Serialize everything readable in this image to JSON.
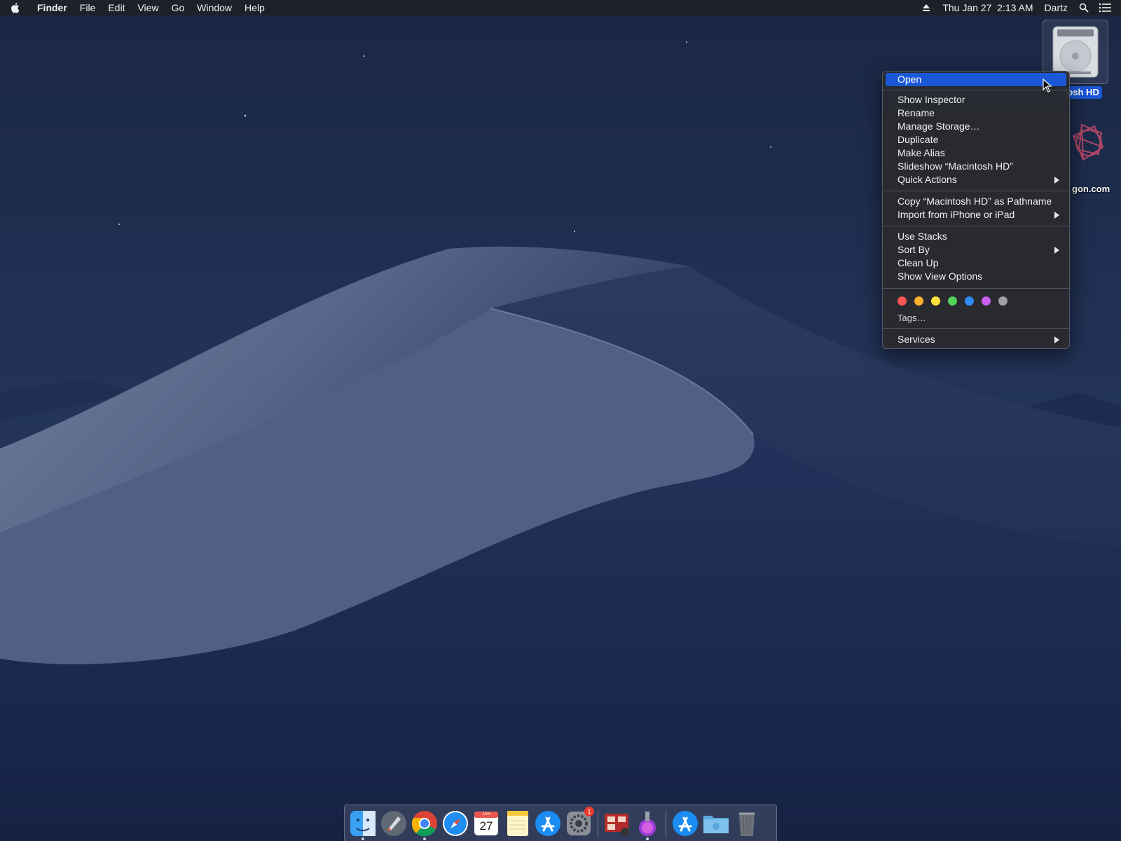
{
  "menubar": {
    "app_name": "Finder",
    "menus": [
      "File",
      "Edit",
      "View",
      "Go",
      "Window",
      "Help"
    ],
    "datetime": "Thu Jan 27  2:13 AM",
    "user": "Dartz",
    "icons": [
      "apple-icon",
      "eject-icon",
      "spotlight-search-icon",
      "notification-center-icon"
    ]
  },
  "desktop": {
    "selected_item_label": "tosh HD",
    "second_item_label": "gon.com"
  },
  "context_menu": {
    "open": "Open",
    "group2": [
      "Show Inspector",
      "Rename",
      "Manage Storage…",
      "Duplicate",
      "Make Alias",
      "Slideshow “Macintosh HD”",
      "Quick Actions"
    ],
    "group3": [
      "Copy “Macintosh HD” as Pathname",
      "Import from iPhone or iPad"
    ],
    "group4": [
      "Use Stacks",
      "Sort By",
      "Clean Up",
      "Show View Options"
    ],
    "tag_colors": [
      "#fc5753",
      "#fdb02c",
      "#fee13c",
      "#52d45a",
      "#2f8cf6",
      "#c760f0",
      "#a0a0a4"
    ],
    "tags_label": "Tags…",
    "services": "Services",
    "highlight_color": "#1b58d8"
  },
  "dock": {
    "items": [
      "finder-icon",
      "launchpad-icon",
      "chrome-icon",
      "safari-icon",
      "calendar-icon",
      "notes-icon",
      "app-store-icon",
      "system-preferences-icon",
      "photo-booth-icon",
      "installer-icon",
      "app-store-folder-icon",
      "documents-folder-icon",
      "trash-icon"
    ],
    "calendar_month": "JAN",
    "calendar_day": "27",
    "system_preferences_badge": "1"
  }
}
